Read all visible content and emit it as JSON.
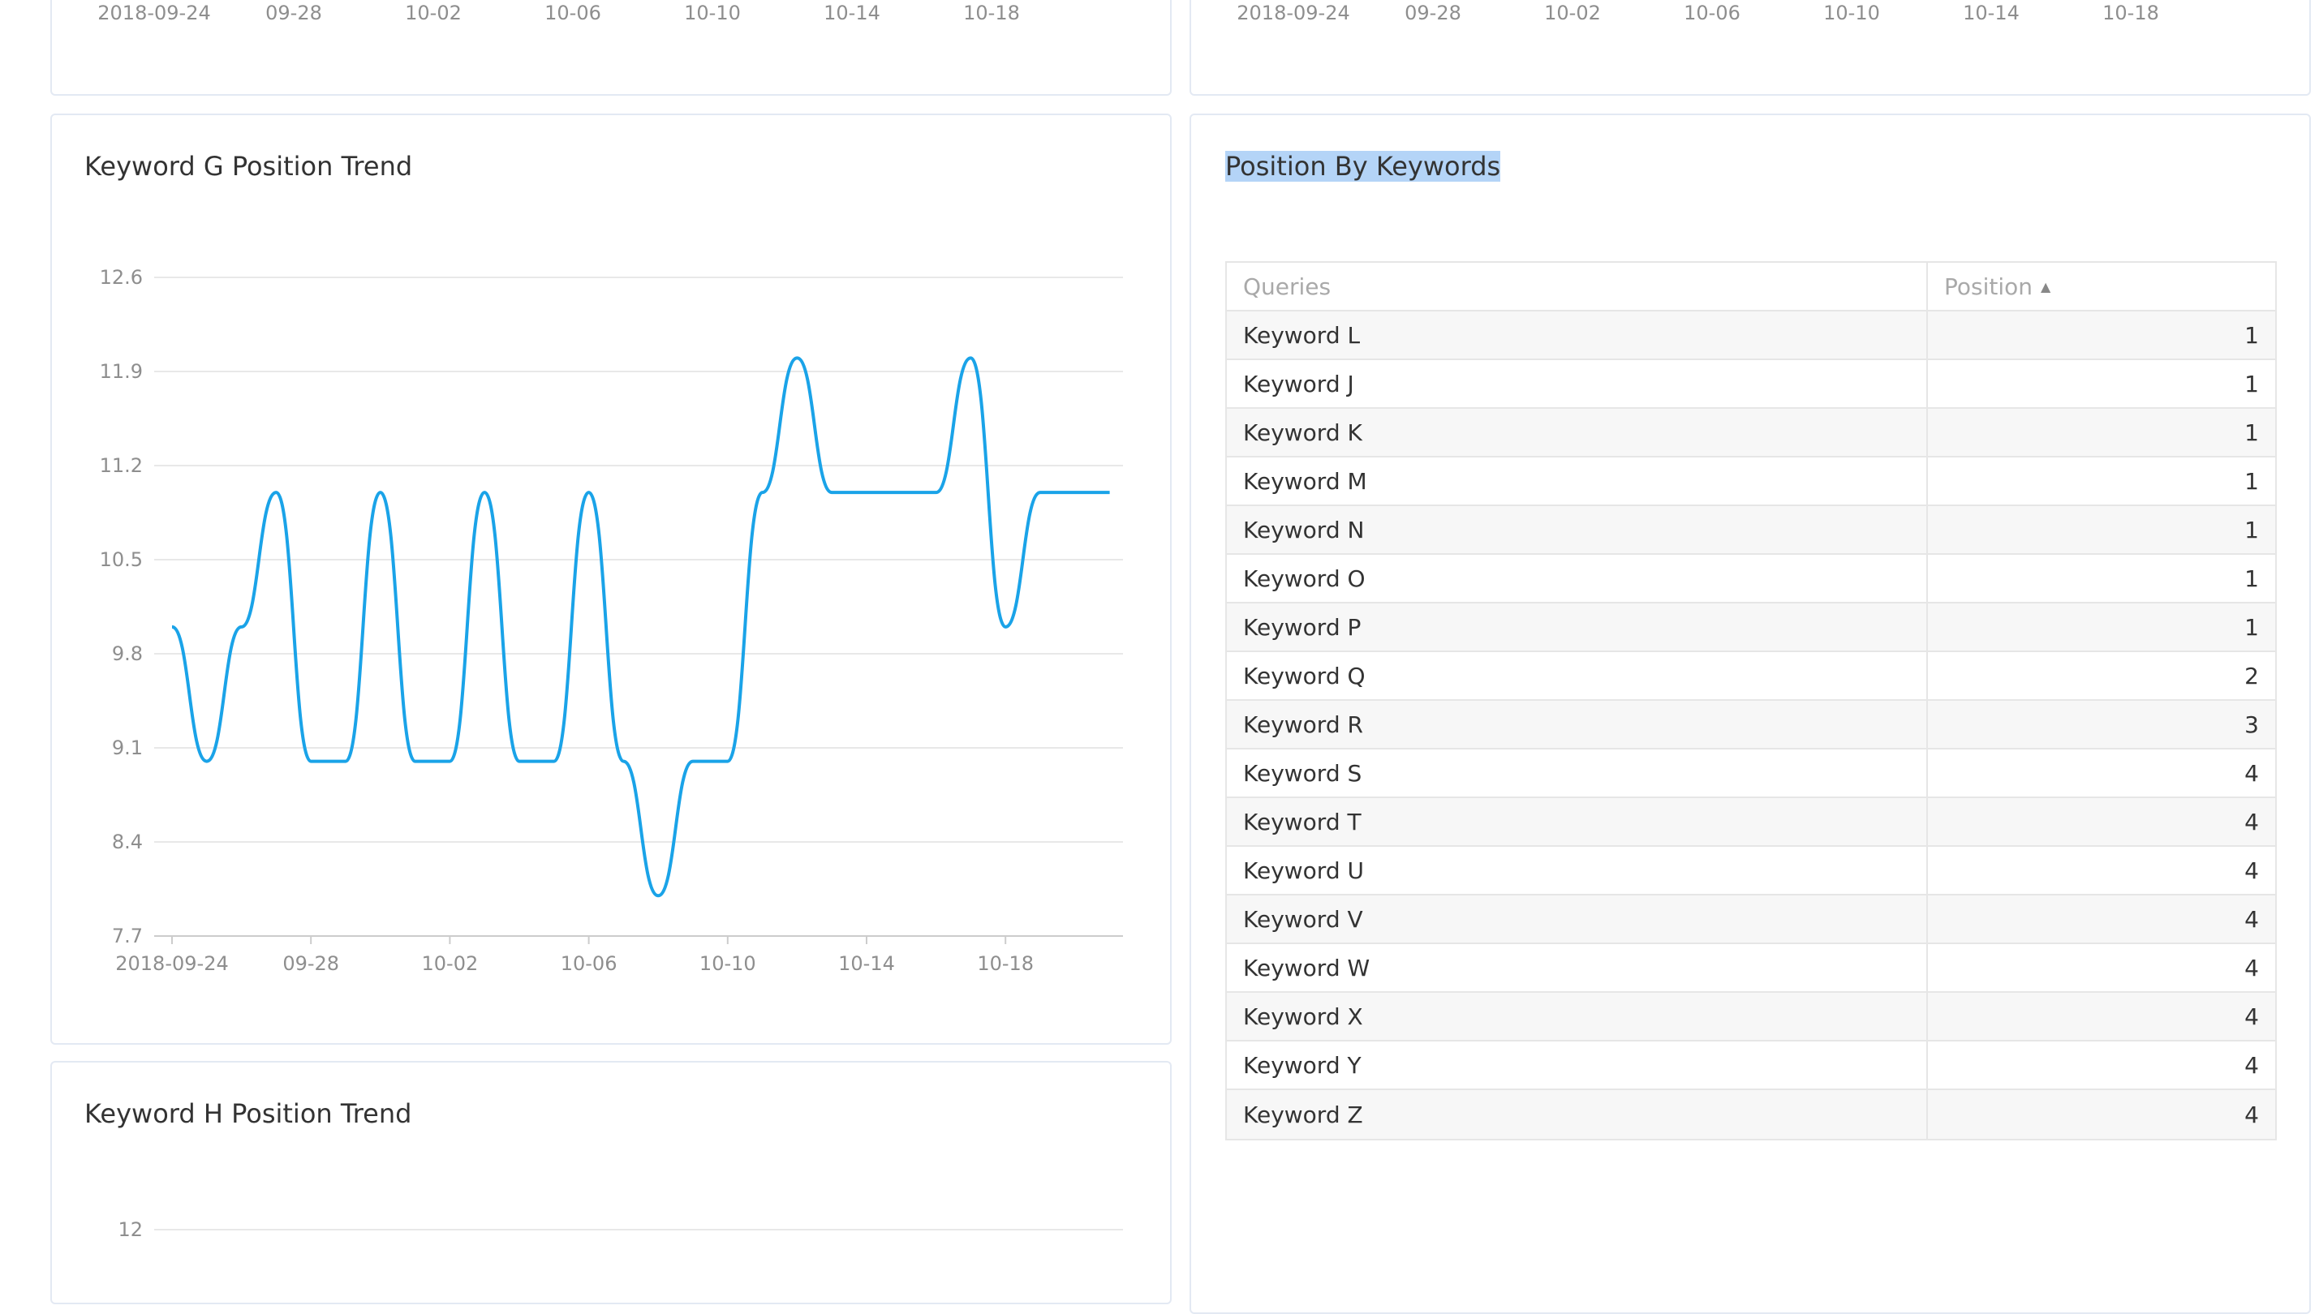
{
  "top_left_card": {
    "x_ticks": [
      "2018-09-24",
      "09-28",
      "10-02",
      "10-06",
      "10-10",
      "10-14",
      "10-18"
    ]
  },
  "top_right_card": {
    "x_ticks": [
      "2018-09-24",
      "09-28",
      "10-02",
      "10-06",
      "10-10",
      "10-14",
      "10-18"
    ]
  },
  "keyword_g_card": {
    "title": "Keyword G Position Trend"
  },
  "keyword_h_card": {
    "title": "Keyword H Position Trend",
    "y_ticks": [
      "12"
    ]
  },
  "colors": {
    "line": "#1aa3e8",
    "grid": "#e8e8e8",
    "axis": "#cccccc",
    "card_border": "#e3e9f3",
    "selection": "#b4d4f7"
  },
  "chart_data": {
    "type": "line",
    "title": "Keyword G Position Trend",
    "x": [
      "2018-09-24",
      "2018-09-25",
      "2018-09-26",
      "2018-09-27",
      "2018-09-28",
      "2018-09-29",
      "2018-09-30",
      "2018-10-01",
      "2018-10-02",
      "2018-10-03",
      "2018-10-04",
      "2018-10-05",
      "2018-10-06",
      "2018-10-07",
      "2018-10-08",
      "2018-10-09",
      "2018-10-10",
      "2018-10-11",
      "2018-10-12",
      "2018-10-13",
      "2018-10-14",
      "2018-10-15",
      "2018-10-16",
      "2018-10-17",
      "2018-10-18",
      "2018-10-19",
      "2018-10-20",
      "2018-10-21"
    ],
    "series": [
      {
        "values": [
          10,
          9,
          10,
          11,
          9,
          9,
          11,
          9,
          9,
          11,
          9,
          9,
          11,
          9,
          8,
          9,
          9,
          11,
          12,
          11,
          11,
          11,
          11,
          12,
          10,
          11,
          11,
          11
        ]
      }
    ],
    "x_ticks": [
      "2018-09-24",
      "09-28",
      "10-02",
      "10-06",
      "10-10",
      "10-14",
      "10-18"
    ],
    "y_ticks": [
      "12.6",
      "11.9",
      "11.2",
      "10.5",
      "9.8",
      "9.1",
      "8.4",
      "7.7"
    ],
    "ylim": [
      7.7,
      12.6
    ],
    "grid": true,
    "legend": "none"
  },
  "keywords_table": {
    "title": "Position By Keywords",
    "headers": {
      "query": "Queries",
      "position": "Position"
    },
    "sort_icon": "sort-ascending-icon",
    "rows": [
      {
        "query": "Keyword L",
        "position": "1"
      },
      {
        "query": "Keyword J",
        "position": "1"
      },
      {
        "query": "Keyword K",
        "position": "1"
      },
      {
        "query": "Keyword M",
        "position": "1"
      },
      {
        "query": "Keyword N",
        "position": "1"
      },
      {
        "query": "Keyword O",
        "position": "1"
      },
      {
        "query": "Keyword P",
        "position": "1"
      },
      {
        "query": "Keyword Q",
        "position": "2"
      },
      {
        "query": "Keyword R",
        "position": "3"
      },
      {
        "query": "Keyword S",
        "position": "4"
      },
      {
        "query": "Keyword T",
        "position": "4"
      },
      {
        "query": "Keyword U",
        "position": "4"
      },
      {
        "query": "Keyword V",
        "position": "4"
      },
      {
        "query": "Keyword W",
        "position": "4"
      },
      {
        "query": "Keyword X",
        "position": "4"
      },
      {
        "query": "Keyword Y",
        "position": "4"
      },
      {
        "query": "Keyword Z",
        "position": "4"
      }
    ]
  }
}
